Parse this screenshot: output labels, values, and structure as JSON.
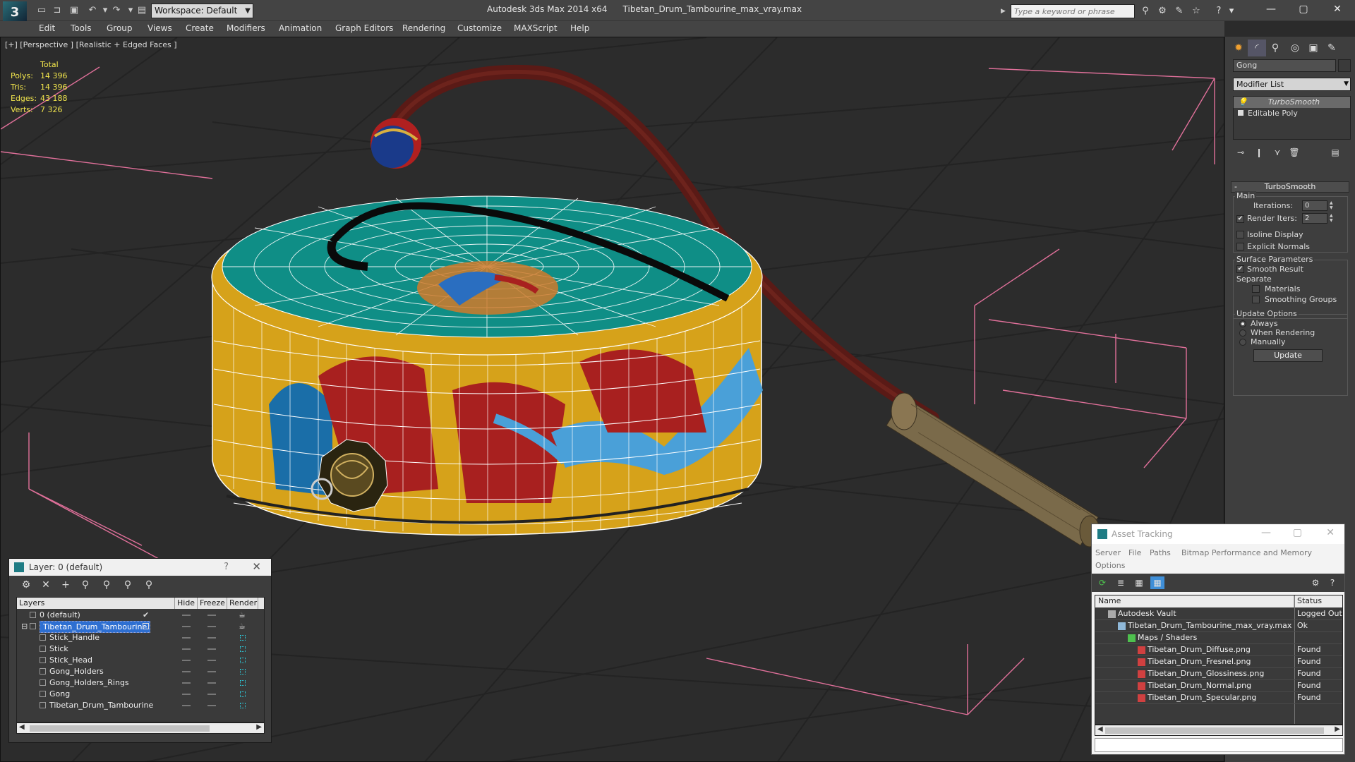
{
  "app": {
    "title": "Autodesk 3ds Max  2014 x64",
    "file": "Tibetan_Drum_Tambourine_max_vray.max",
    "workspace": "Workspace: Default",
    "search_placeholder": "Type a keyword or phrase",
    "logo_text": "3"
  },
  "menu": [
    "Edit",
    "Tools",
    "Group",
    "Views",
    "Create",
    "Modifiers",
    "Animation",
    "Graph Editors",
    "Rendering",
    "Customize",
    "MAXScript",
    "Help"
  ],
  "viewport": {
    "label": "[+] [Perspective ] [Realistic + Edged Faces ]",
    "stats": {
      "header": "Total",
      "rows": [
        {
          "label": "Polys:",
          "value": "14 396"
        },
        {
          "label": "Tris:",
          "value": "14 396"
        },
        {
          "label": "Edges:",
          "value": "43 188"
        },
        {
          "label": "Verts:",
          "value": "7 326"
        }
      ]
    }
  },
  "command_panel": {
    "object_name": "Gong",
    "modifier_list": "Modifier List",
    "stack": [
      "TurboSmooth",
      "Editable Poly"
    ],
    "rollout_title": "TurboSmooth",
    "main_group": "Main",
    "iterations_label": "Iterations:",
    "iterations_value": "0",
    "render_iters_label": "Render Iters:",
    "render_iters_value": "2",
    "isoline_label": "Isoline Display",
    "explicit_normals_label": "Explicit Normals",
    "surface_group": "Surface Parameters",
    "smooth_result_label": "Smooth Result",
    "separate_label": "Separate",
    "materials_label": "Materials",
    "smoothing_groups_label": "Smoothing Groups",
    "update_group": "Update Options",
    "always_label": "Always",
    "when_rendering_label": "When Rendering",
    "manually_label": "Manually",
    "update_button": "Update"
  },
  "layer_panel": {
    "title": "Layer: 0 (default)",
    "help": "?",
    "close": "✕",
    "columns": [
      "Layers",
      "Hide",
      "Freeze",
      "Render"
    ],
    "rows": [
      {
        "name": "0 (default)",
        "level": 1,
        "selected": false,
        "check": "✔"
      },
      {
        "name": "Tibetan_Drum_Tambourine",
        "level": 1,
        "selected": true,
        "check": ""
      },
      {
        "name": "Stick_Handle",
        "level": 2,
        "selected": false,
        "check": ""
      },
      {
        "name": "Stick",
        "level": 2,
        "selected": false,
        "check": ""
      },
      {
        "name": "Stick_Head",
        "level": 2,
        "selected": false,
        "check": ""
      },
      {
        "name": "Gong_Holders",
        "level": 2,
        "selected": false,
        "check": ""
      },
      {
        "name": "Gong_Holders_Rings",
        "level": 2,
        "selected": false,
        "check": ""
      },
      {
        "name": "Gong",
        "level": 2,
        "selected": false,
        "check": ""
      },
      {
        "name": "Tibetan_Drum_Tambourine",
        "level": 2,
        "selected": false,
        "check": ""
      }
    ]
  },
  "asset_panel": {
    "title": "Asset Tracking",
    "menu": [
      "Server",
      "File",
      "Paths",
      "Bitmap Performance and Memory",
      "Options"
    ],
    "columns": [
      "Name",
      "Status"
    ],
    "rows": [
      {
        "name": "Autodesk Vault",
        "status": "Logged Out",
        "indent": 1,
        "icon": "vault"
      },
      {
        "name": "Tibetan_Drum_Tambourine_max_vray.max",
        "status": "Ok",
        "indent": 2,
        "icon": "max"
      },
      {
        "name": "Maps / Shaders",
        "status": "",
        "indent": 3,
        "icon": "maps"
      },
      {
        "name": "Tibetan_Drum_Diffuse.png",
        "status": "Found",
        "indent": 4,
        "icon": "png"
      },
      {
        "name": "Tibetan_Drum_Fresnel.png",
        "status": "Found",
        "indent": 4,
        "icon": "png"
      },
      {
        "name": "Tibetan_Drum_Glossiness.png",
        "status": "Found",
        "indent": 4,
        "icon": "png"
      },
      {
        "name": "Tibetan_Drum_Normal.png",
        "status": "Found",
        "indent": 4,
        "icon": "png"
      },
      {
        "name": "Tibetan_Drum_Specular.png",
        "status": "Found",
        "indent": 4,
        "icon": "png"
      }
    ]
  },
  "colors": {
    "ui_dark": "#444444",
    "stats_yellow": "#f1e54c",
    "selection_blue": "#2e6fd1",
    "drum_teal": "#0f8e86",
    "drum_gold": "#d6a21a",
    "drum_red": "#a8201f",
    "stick_red": "#5a1a16",
    "handle_brown": "#7a6a4a",
    "bbox_pink": "#e0709a"
  }
}
